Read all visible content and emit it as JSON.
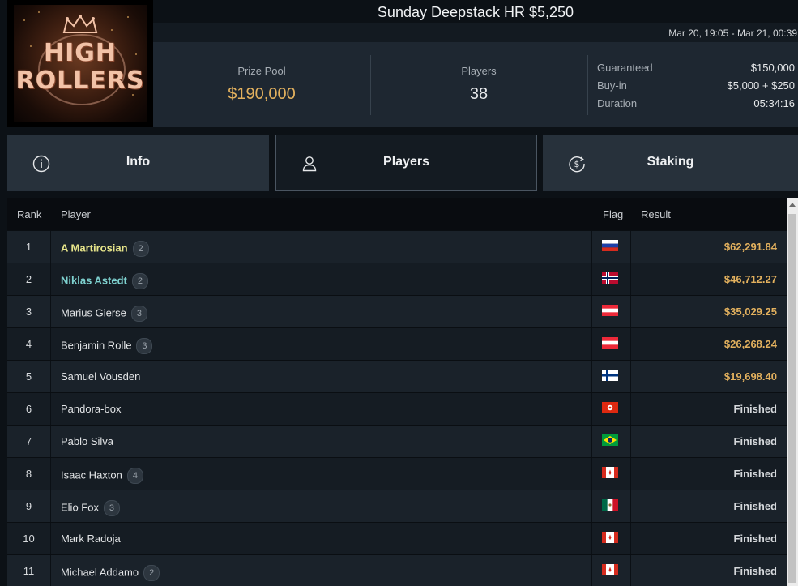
{
  "header": {
    "title": "Sunday Deepstack HR $5,250",
    "date_range": "Mar 20, 19:05 - Mar 21, 00:39",
    "logo": {
      "line1": "HIGH",
      "line2": "ROLLERS"
    }
  },
  "stats": {
    "prize_pool": {
      "label": "Prize Pool",
      "value": "$190,000"
    },
    "players": {
      "label": "Players",
      "value": "38"
    },
    "details": [
      {
        "label": "Guaranteed",
        "value": "$150,000"
      },
      {
        "label": "Buy-in",
        "value": "$5,000 + $250"
      },
      {
        "label": "Duration",
        "value": "05:34:16"
      }
    ]
  },
  "tabs": [
    {
      "label": "Info",
      "icon": "info-icon"
    },
    {
      "label": "Players",
      "icon": "user-icon",
      "active": true
    },
    {
      "label": "Staking",
      "icon": "dollar-cycle-icon"
    }
  ],
  "table": {
    "headers": {
      "rank": "Rank",
      "player": "Player",
      "flag": "Flag",
      "result": "Result"
    },
    "rows": [
      {
        "rank": "1",
        "player": "A Martirosian",
        "badge": "2",
        "flag": "russia",
        "result": "$62,291.84",
        "kind": "money",
        "style": "gold"
      },
      {
        "rank": "2",
        "player": "Niklas Astedt",
        "badge": "2",
        "flag": "norway",
        "result": "$46,712.27",
        "kind": "money",
        "style": "teal"
      },
      {
        "rank": "3",
        "player": "Marius Gierse",
        "badge": "3",
        "flag": "austria",
        "result": "$35,029.25",
        "kind": "money",
        "style": ""
      },
      {
        "rank": "4",
        "player": "Benjamin Rolle",
        "badge": "3",
        "flag": "austria",
        "result": "$26,268.24",
        "kind": "money",
        "style": ""
      },
      {
        "rank": "5",
        "player": "Samuel Vousden",
        "badge": "",
        "flag": "finland",
        "result": "$19,698.40",
        "kind": "money",
        "style": ""
      },
      {
        "rank": "6",
        "player": "Pandora-box",
        "badge": "",
        "flag": "hong-kong",
        "result": "Finished",
        "kind": "fin",
        "style": ""
      },
      {
        "rank": "7",
        "player": "Pablo Silva",
        "badge": "",
        "flag": "brazil",
        "result": "Finished",
        "kind": "fin",
        "style": ""
      },
      {
        "rank": "8",
        "player": "Isaac Haxton",
        "badge": "4",
        "flag": "canada",
        "result": "Finished",
        "kind": "fin",
        "style": ""
      },
      {
        "rank": "9",
        "player": "Elio Fox",
        "badge": "3",
        "flag": "mexico",
        "result": "Finished",
        "kind": "fin",
        "style": ""
      },
      {
        "rank": "10",
        "player": "Mark Radoja",
        "badge": "",
        "flag": "canada",
        "result": "Finished",
        "kind": "fin",
        "style": ""
      },
      {
        "rank": "11",
        "player": "Michael Addamo",
        "badge": "2",
        "flag": "canada",
        "result": "Finished",
        "kind": "fin",
        "style": ""
      }
    ]
  },
  "colors": {
    "prize": "#e3b15e",
    "money": "#e3b15e",
    "leader": "#e7e58a",
    "second": "#7ed1cf"
  }
}
